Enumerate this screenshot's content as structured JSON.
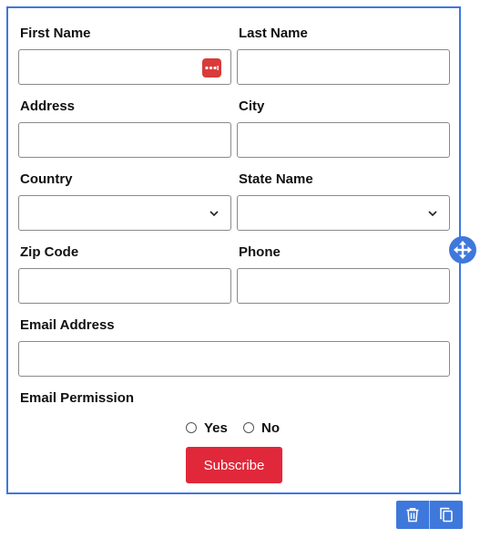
{
  "form": {
    "first_name": {
      "label": "First Name",
      "value": ""
    },
    "last_name": {
      "label": "Last Name",
      "value": ""
    },
    "address": {
      "label": "Address",
      "value": ""
    },
    "city": {
      "label": "City",
      "value": ""
    },
    "country": {
      "label": "Country",
      "selected": ""
    },
    "state": {
      "label": "State Name",
      "selected": ""
    },
    "zip": {
      "label": "Zip Code",
      "value": ""
    },
    "phone": {
      "label": "Phone",
      "value": ""
    },
    "email": {
      "label": "Email Address",
      "value": ""
    },
    "email_permission": {
      "label": "Email Permission",
      "options": [
        "Yes",
        "No"
      ],
      "selected": null
    },
    "submit_label": "Subscribe"
  },
  "icons": {
    "password_manager": "password-manager-icon",
    "select_chevron": "chevron-down-icon",
    "move": "move-icon",
    "delete": "trash-icon",
    "duplicate": "duplicate-icon"
  },
  "colors": {
    "accent": "#3f78dc",
    "submit": "#e0283a",
    "password_icon": "#d93a3a"
  }
}
